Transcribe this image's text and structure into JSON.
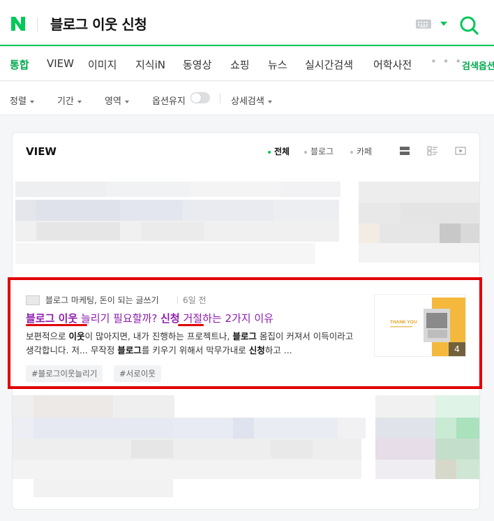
{
  "header": {
    "query": "블로그 이웃 신청"
  },
  "tabs": [
    {
      "label": "통합",
      "active": true
    },
    {
      "label": "VIEW"
    },
    {
      "label": "이미지"
    },
    {
      "label": "지식iN"
    },
    {
      "label": "동영상"
    },
    {
      "label": "쇼핑"
    },
    {
      "label": "뉴스"
    },
    {
      "label": "실시간검색"
    },
    {
      "label": "어학사전"
    }
  ],
  "tabs_more": "• • •",
  "search_options_label": "검색옵션",
  "filters": {
    "sort": "정렬",
    "period": "기간",
    "area": "영역",
    "keep_options": "옵션유지",
    "detail": "상세검색"
  },
  "view_section": {
    "title": "VIEW",
    "source_filters": [
      "전체",
      "블로그",
      "카페"
    ]
  },
  "result": {
    "source": "블로그 마케팅, 돈이 되는 글쓰기",
    "date": "6일 전",
    "title": {
      "part1": "블로그 이웃",
      "part2": " 늘리기 필요할까? ",
      "part3": "신청",
      "part4": " 거절하는 2가지 이유"
    },
    "desc": {
      "s1": "보편적으로 ",
      "s2": "이웃",
      "s3": "이 많아지면, 내가 진행하는 프로젝트나, ",
      "s4": "블로그",
      "s5": " 몸집이 커져서 이득이라고 생각합니다. 저... 무작정 ",
      "s6": "블로그",
      "s7": "를 키우기 위해서 막무가내로 ",
      "s8": "신청",
      "s9": "하고 ..."
    },
    "tags": [
      "#블로그이웃늘리기",
      "#서로이웃"
    ],
    "thumbnail_text": "THANK YOU",
    "image_count": "4"
  },
  "colors": {
    "brand_green": "#03c75a",
    "highlight_red": "#e00000",
    "title_purple": "#8e1cae"
  }
}
